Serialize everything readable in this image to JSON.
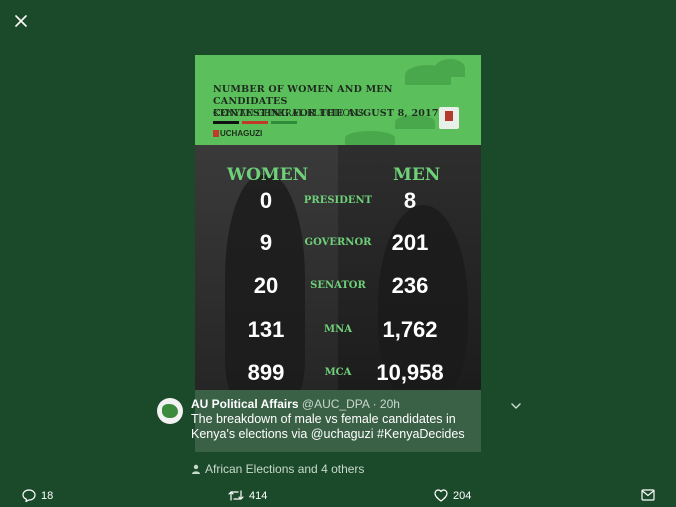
{
  "viewer": {
    "close_icon": "close-icon"
  },
  "infographic": {
    "title_line1": "NUMBER OF WOMEN AND MEN CANDIDATES",
    "title_line2": "CONTESTING FOR THE AUGUST 8, 2017",
    "subtitle": "KENYAN GENERAL ELECTIONS",
    "brand": "UCHAGUZI",
    "women_header": "WOMEN",
    "men_header": "MEN",
    "rows": [
      {
        "label": "PRESIDENT",
        "women": "0",
        "men": "8"
      },
      {
        "label": "GOVERNOR",
        "women": "9",
        "men": "201"
      },
      {
        "label": "SENATOR",
        "women": "20",
        "men": "236"
      },
      {
        "label": "MNA",
        "women": "131",
        "men": "1,762"
      },
      {
        "label": "MCA",
        "women": "899",
        "men": "10,958"
      }
    ],
    "colors": {
      "header_bg": "#5bc05c",
      "accent_text": "#6fd07a",
      "stripe_black": "#111111",
      "stripe_red": "#c0392b",
      "stripe_green": "#2e8b3a"
    }
  },
  "tweet": {
    "author": "AU Political Affairs",
    "handle_time": "@AUC_DPA · 20h",
    "text": "The breakdown of male vs female candidates in Kenya's elections via @uchaguzi #KenyaDecides",
    "context": "African Elections and 4 others"
  },
  "actions": {
    "reply_count": "18",
    "retweet_count": "414",
    "like_count": "204"
  }
}
